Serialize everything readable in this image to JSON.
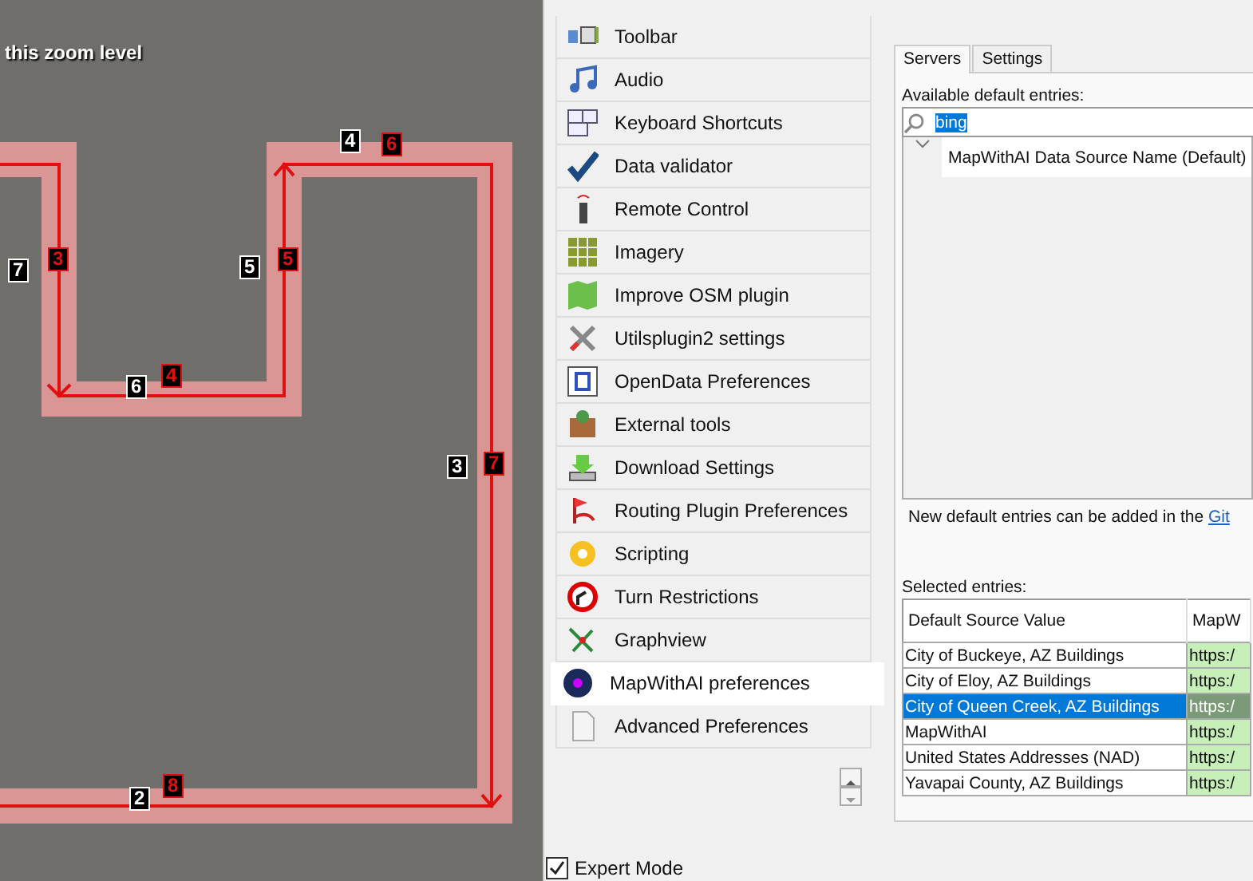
{
  "map": {
    "notice": "this zoom level",
    "segment_labels": [
      {
        "text": "7",
        "color": "#ffffff"
      },
      {
        "text": "3",
        "color": "#e01010"
      },
      {
        "text": "6",
        "color": "#ffffff"
      },
      {
        "text": "4",
        "color": "#e01010"
      },
      {
        "text": "5",
        "color": "#ffffff"
      },
      {
        "text": "5",
        "color": "#e01010"
      },
      {
        "text": "4",
        "color": "#ffffff"
      },
      {
        "text": "6",
        "color": "#e01010"
      },
      {
        "text": "3",
        "color": "#ffffff"
      },
      {
        "text": "7",
        "color": "#e01010"
      },
      {
        "text": "2",
        "color": "#ffffff"
      },
      {
        "text": "8",
        "color": "#e01010"
      }
    ]
  },
  "sidebar": {
    "items": [
      {
        "label": "Toolbar",
        "selected": false
      },
      {
        "label": "Audio",
        "selected": false
      },
      {
        "label": "Keyboard Shortcuts",
        "selected": false
      },
      {
        "label": "Data validator",
        "selected": false
      },
      {
        "label": "Remote Control",
        "selected": false
      },
      {
        "label": "Imagery",
        "selected": false
      },
      {
        "label": "Improve OSM plugin",
        "selected": false
      },
      {
        "label": "Utilsplugin2 settings",
        "selected": false
      },
      {
        "label": "OpenData Preferences",
        "selected": false
      },
      {
        "label": "External tools",
        "selected": false
      },
      {
        "label": "Download Settings",
        "selected": false
      },
      {
        "label": "Routing Plugin Preferences",
        "selected": false
      },
      {
        "label": "Scripting",
        "selected": false
      },
      {
        "label": "Turn Restrictions",
        "selected": false
      },
      {
        "label": "Graphview",
        "selected": false
      },
      {
        "label": "MapWithAI preferences",
        "selected": true
      },
      {
        "label": "Advanced Preferences",
        "selected": false
      }
    ],
    "expert_mode": {
      "label": "Expert Mode",
      "checked": true
    }
  },
  "tabs": [
    {
      "label": "Servers",
      "selected": true
    },
    {
      "label": "Settings",
      "selected": false
    }
  ],
  "available": {
    "label": "Available default entries:",
    "search": {
      "value": "bing"
    },
    "tree_row": "MapWithAI Data Source Name (Default)",
    "note": "New default entries can be added in the ",
    "note_link": "Git"
  },
  "selected_entries": {
    "label": "Selected entries:",
    "columns": [
      "Default Source Value",
      "MapW"
    ],
    "rows": [
      {
        "cells": [
          "City of Buckeye, AZ Buildings",
          "https:/"
        ],
        "selected": false
      },
      {
        "cells": [
          "City of Eloy, AZ Buildings",
          "https:/"
        ],
        "selected": false
      },
      {
        "cells": [
          "City of Queen Creek, AZ Buildings",
          "https:/"
        ],
        "selected": true
      },
      {
        "cells": [
          "MapWithAI",
          "https:/"
        ],
        "selected": false
      },
      {
        "cells": [
          "United States Addresses (NAD)",
          "https:/"
        ],
        "selected": false
      },
      {
        "cells": [
          "Yavapai County, AZ Buildings",
          "https:/"
        ],
        "selected": false
      }
    ]
  }
}
